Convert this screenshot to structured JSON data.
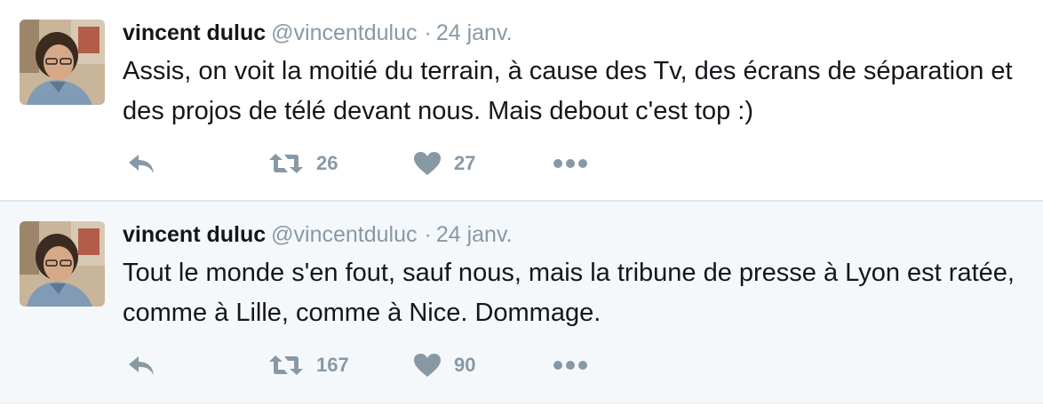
{
  "colors": {
    "name": "#14171a",
    "meta": "#8899a6",
    "icon": "#8899a6",
    "alt_background": "#f5f8fa",
    "divider": "#e1e8ed"
  },
  "icons": {
    "reply": "reply-arrow-icon",
    "retweet": "retweet-icon",
    "like": "heart-icon",
    "more": "more-dots-icon"
  },
  "tweets": [
    {
      "name": "vincent duluc",
      "handle": "@vincentduluc",
      "separator": "·",
      "date": "24 janv.",
      "text": "Assis, on voit la moitié du terrain, à cause des Tv, des écrans de séparation et des projos de télé devant nous. Mais debout c'est top :)",
      "retweets": "26",
      "likes": "27"
    },
    {
      "name": "vincent duluc",
      "handle": "@vincentduluc",
      "separator": "·",
      "date": "24 janv.",
      "text": "Tout le monde s'en fout, sauf nous, mais la tribune de presse à Lyon est ratée, comme à Lille, comme à Nice. Dommage.",
      "retweets": "167",
      "likes": "90"
    }
  ]
}
